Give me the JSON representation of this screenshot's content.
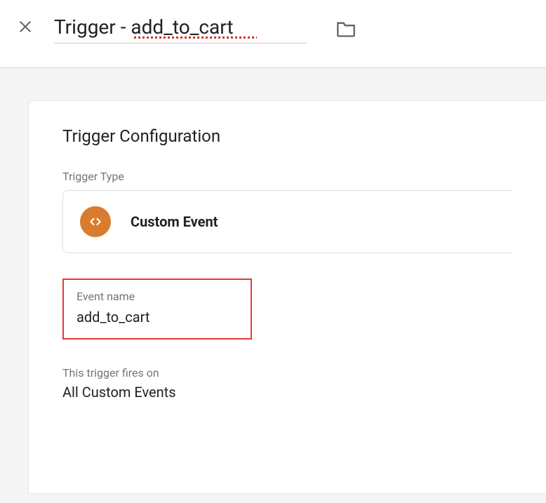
{
  "header": {
    "title_value": "Trigger - add_to_cart"
  },
  "card": {
    "title": "Trigger Configuration",
    "trigger_type_label": "Trigger Type",
    "trigger_type_value": "Custom Event",
    "event_name_label": "Event name",
    "event_name_value": "add_to_cart",
    "fires_on_label": "This trigger fires on",
    "fires_on_value": "All Custom Events"
  }
}
